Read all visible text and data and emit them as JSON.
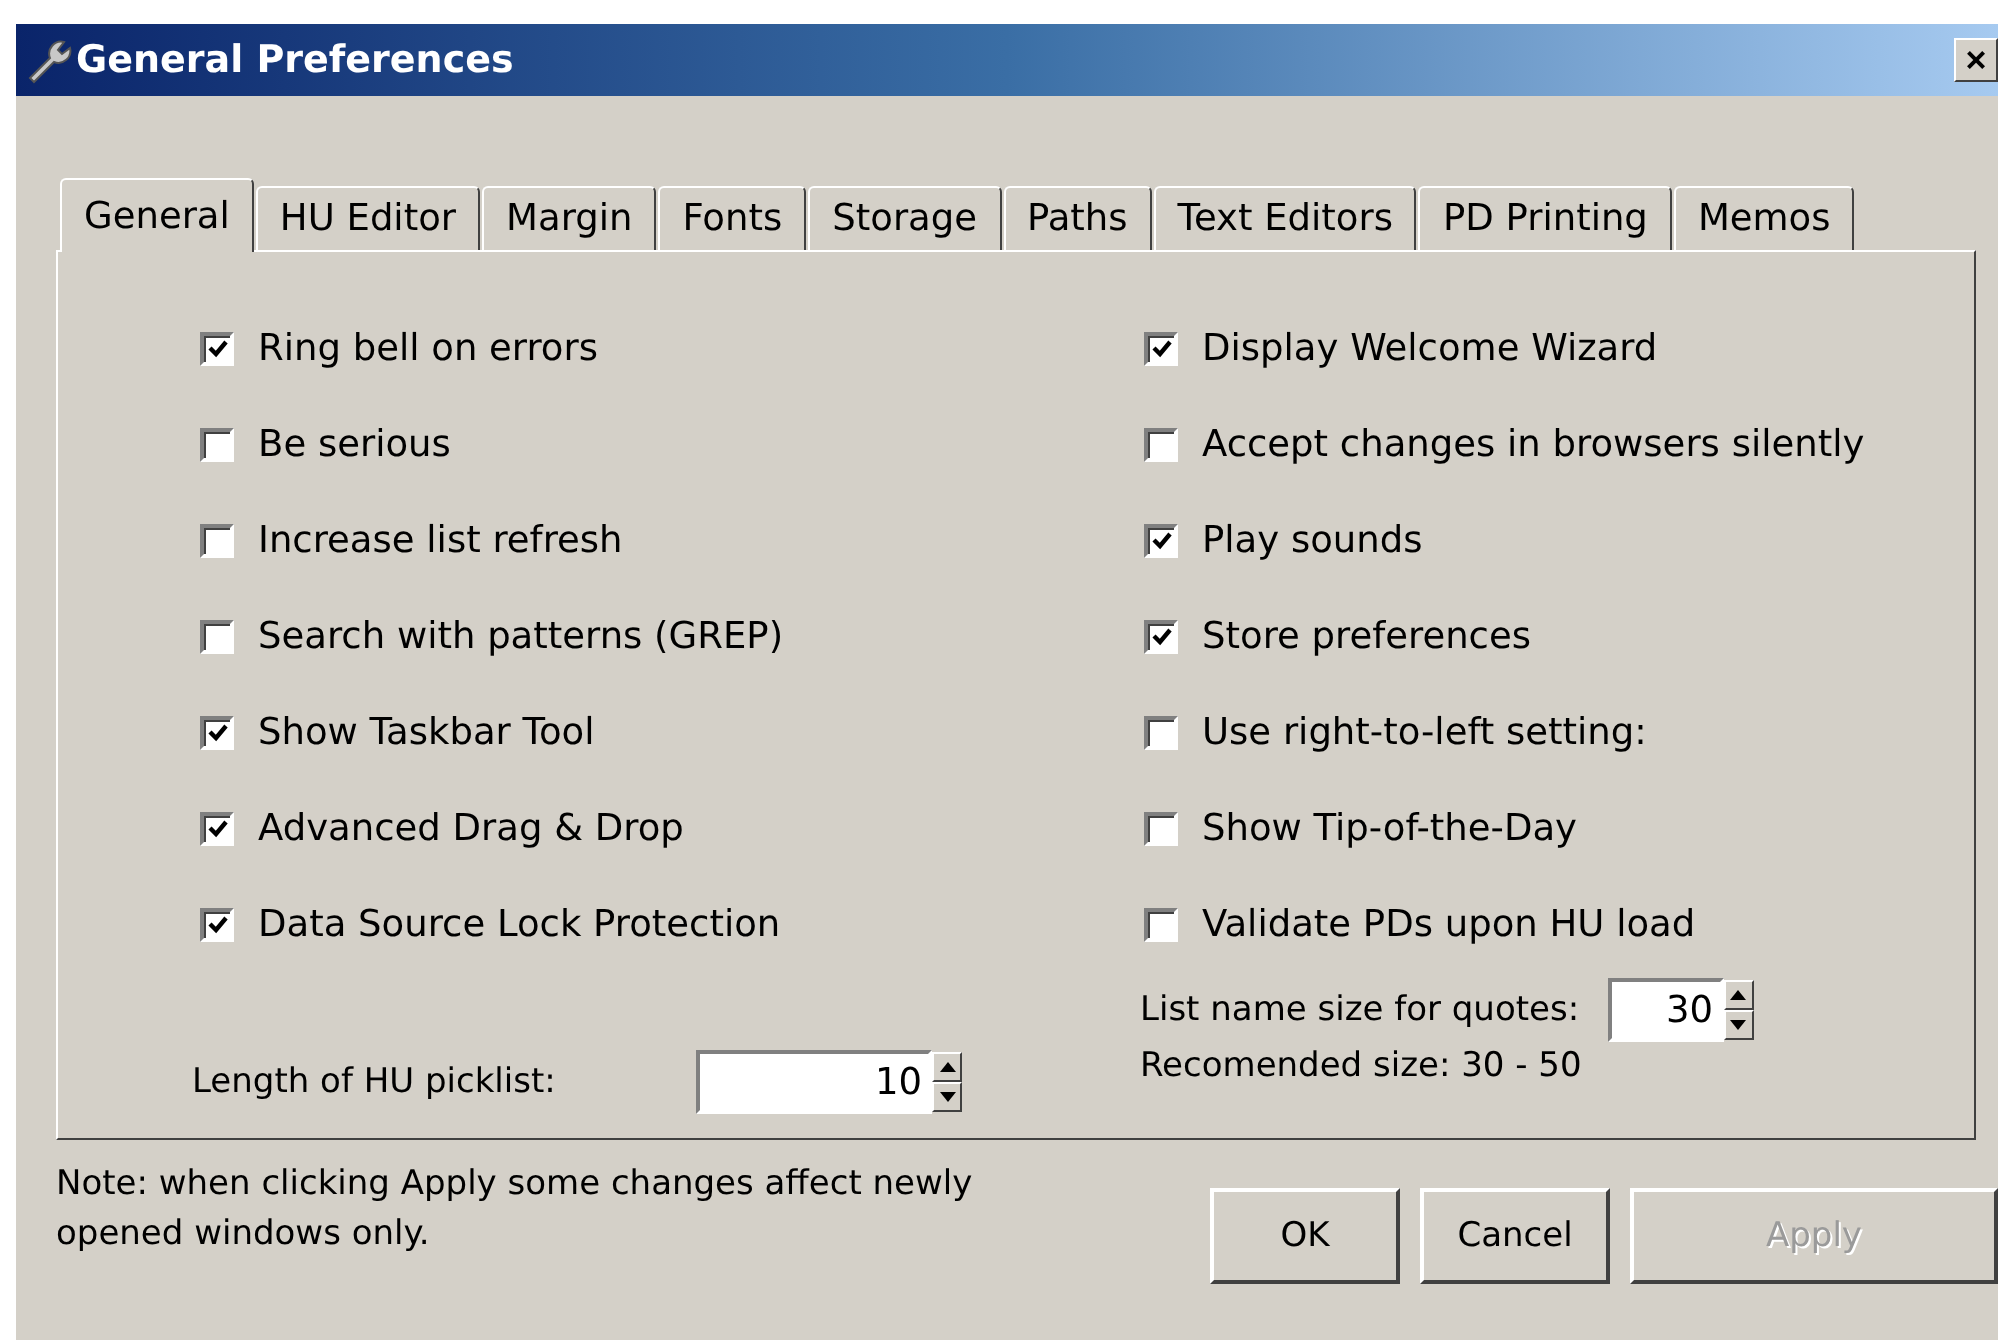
{
  "window": {
    "title": "General Preferences",
    "close": "×"
  },
  "tabs": [
    {
      "label": "General",
      "selected": true
    },
    {
      "label": "HU Editor",
      "selected": false
    },
    {
      "label": "Margin",
      "selected": false
    },
    {
      "label": "Fonts",
      "selected": false
    },
    {
      "label": "Storage",
      "selected": false
    },
    {
      "label": "Paths",
      "selected": false
    },
    {
      "label": "Text Editors",
      "selected": false
    },
    {
      "label": "PD Printing",
      "selected": false
    },
    {
      "label": "Memos",
      "selected": false
    }
  ],
  "left_options": [
    {
      "label": "Ring bell on errors",
      "checked": true
    },
    {
      "label": "Be serious",
      "checked": false
    },
    {
      "label": "Increase list refresh",
      "checked": false
    },
    {
      "label": "Search with patterns (GREP)",
      "checked": false
    },
    {
      "label": "Show Taskbar Tool",
      "checked": true
    },
    {
      "label": "Advanced Drag &  Drop",
      "checked": true
    },
    {
      "label": "Data Source Lock Protection",
      "checked": true
    }
  ],
  "right_options": [
    {
      "label": "Display Welcome Wizard",
      "checked": true
    },
    {
      "label": "Accept changes in browsers silently",
      "checked": false
    },
    {
      "label": "Play sounds",
      "checked": true
    },
    {
      "label": "Store preferences",
      "checked": true
    },
    {
      "label": "Use right-to-left setting:",
      "checked": false
    },
    {
      "label": "Show Tip-of-the-Day",
      "checked": false
    },
    {
      "label": "Validate PDs upon HU load",
      "checked": false
    }
  ],
  "picklist": {
    "label": "Length of HU picklist:",
    "value": "10"
  },
  "quotes": {
    "label": "List name size for quotes:",
    "value": "30",
    "hint": "Recomended size: 30 - 50"
  },
  "note": "Note: when clicking Apply some changes affect newly opened windows only.",
  "buttons": [
    {
      "label": "OK",
      "disabled": false
    },
    {
      "label": "Cancel",
      "disabled": false
    },
    {
      "label": "Apply",
      "disabled": true
    }
  ]
}
